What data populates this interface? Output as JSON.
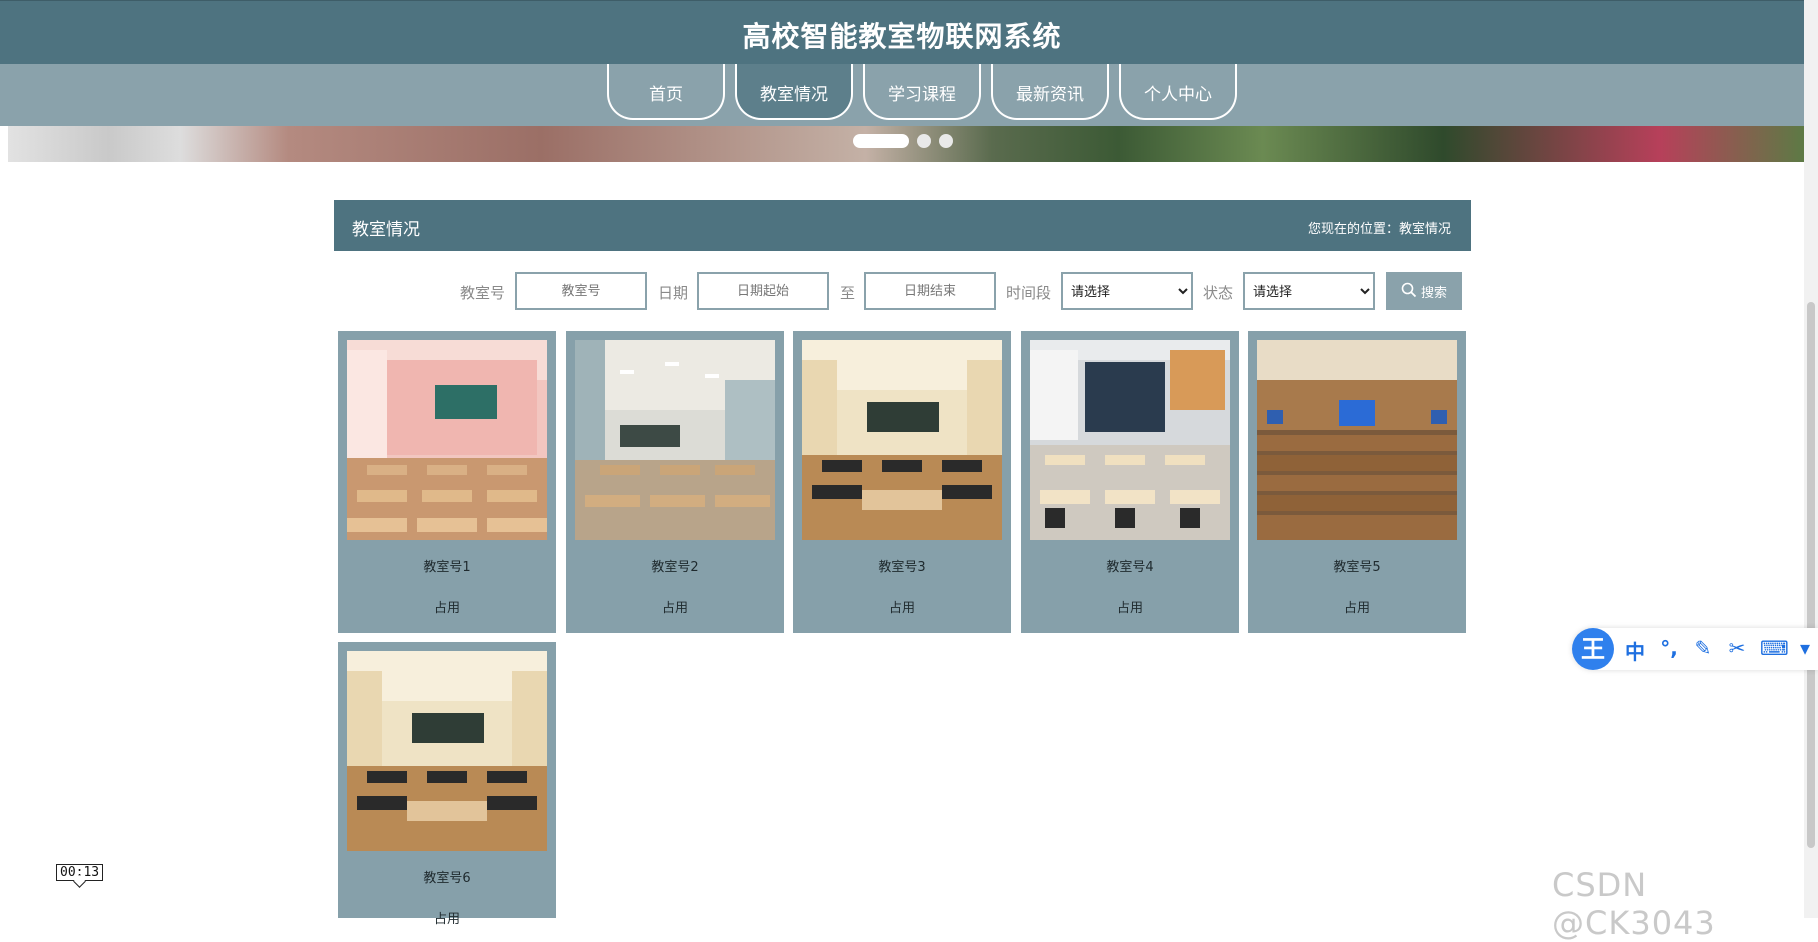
{
  "header": {
    "site_title": "高校智能教室物联网系统"
  },
  "nav": {
    "items": [
      {
        "label": "首页"
      },
      {
        "label": "教室情况",
        "active": true
      },
      {
        "label": "学习课程"
      },
      {
        "label": "最新资讯"
      },
      {
        "label": "个人中心"
      }
    ]
  },
  "banner": {
    "slide_count": 3,
    "active_slide": 1
  },
  "section": {
    "title": "教室情况",
    "breadcrumb": "您现在的位置：教室情况"
  },
  "search": {
    "room_label": "教室号",
    "room_placeholder": "教室号",
    "date_label": "日期",
    "date_start_placeholder": "日期起始",
    "date_to": "至",
    "date_end_placeholder": "日期结束",
    "timeslot_label": "时间段",
    "timeslot_value": "请选择",
    "status_label": "状态",
    "status_value": "请选择",
    "button_label": "搜索"
  },
  "classrooms": [
    {
      "name": "教室号1",
      "status": "占用"
    },
    {
      "name": "教室号2",
      "status": "占用"
    },
    {
      "name": "教室号3",
      "status": "占用"
    },
    {
      "name": "教室号4",
      "status": "占用"
    },
    {
      "name": "教室号5",
      "status": "占用"
    },
    {
      "name": "教室号6",
      "status": "占用"
    }
  ],
  "ime": {
    "logo": "王",
    "mode": "中",
    "icons": [
      "punctuation-icon",
      "pen-icon",
      "scissors-icon",
      "keyboard-icon",
      "shirt-icon"
    ]
  },
  "overlay": {
    "timer": "00:13",
    "watermark": "CSDN @CK3043"
  },
  "colors": {
    "primary": "#4e7380",
    "secondary": "#8aa2ab",
    "card": "#86a0aa"
  }
}
